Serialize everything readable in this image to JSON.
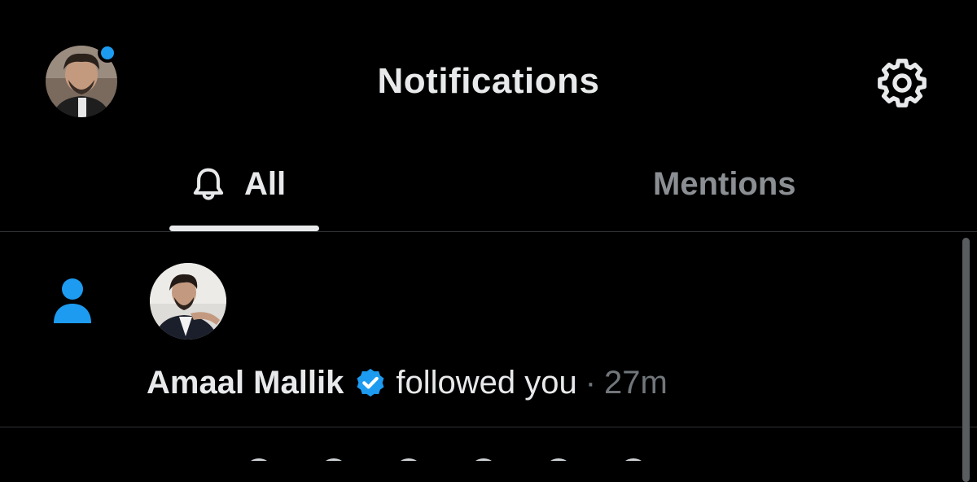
{
  "header": {
    "title": "Notifications",
    "avatar_icon": "profile-avatar-icon",
    "settings_icon": "gear-icon",
    "unread_dot_color": "#1d9bf0"
  },
  "tabs": [
    {
      "label": "All",
      "icon": "bell-icon",
      "active": true
    },
    {
      "label": "Mentions",
      "active": false
    }
  ],
  "notifications": [
    {
      "type": "follow",
      "icon": "person-icon",
      "user_name": "Amaal Mallik",
      "verified": true,
      "action": "followed you",
      "separator": "·",
      "time": "27m"
    }
  ],
  "colors": {
    "background": "#000000",
    "text_primary": "#e7e9ea",
    "text_secondary": "#71767b",
    "accent": "#1d9bf0",
    "divider": "#2f3336"
  }
}
